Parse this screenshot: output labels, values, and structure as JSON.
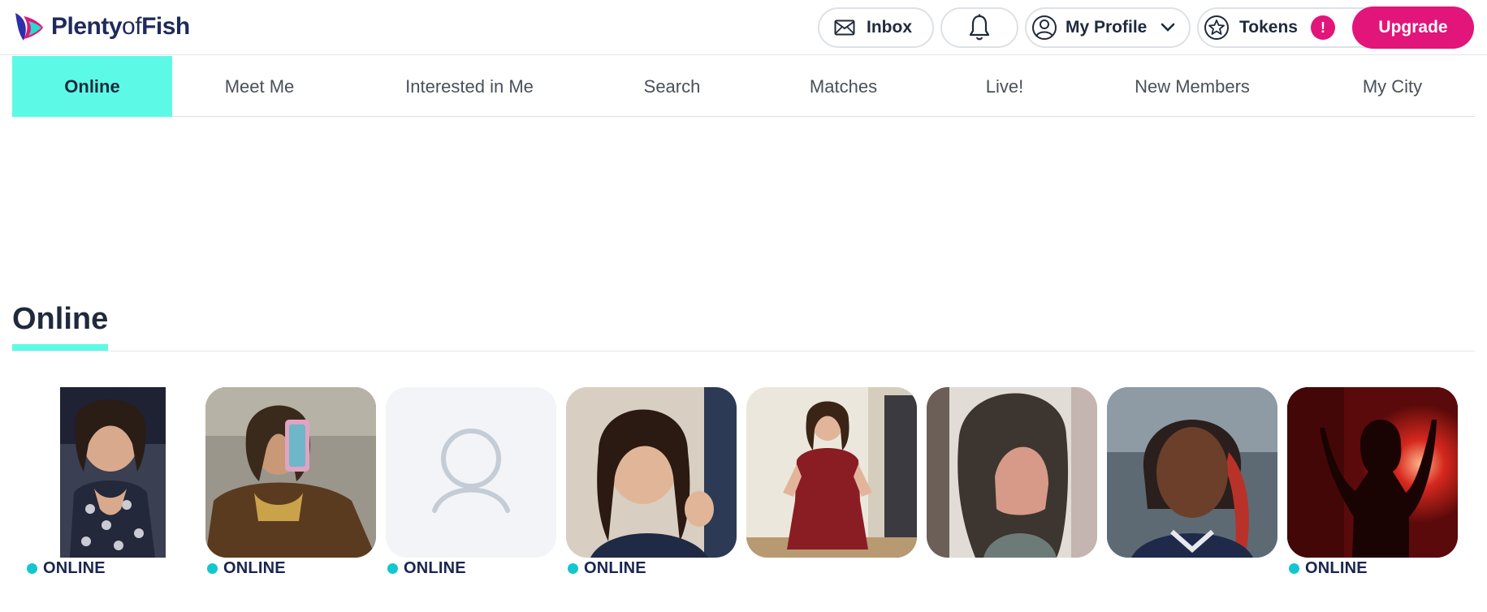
{
  "header": {
    "logo_text_bold": "Plenty",
    "logo_text_light": "of",
    "logo_text_end": "Fish",
    "inbox_label": "Inbox",
    "profile_label": "My Profile",
    "tokens_label": "Tokens",
    "tokens_badge": "!",
    "upgrade_label": "Upgrade",
    "accent_color": "#e2157a"
  },
  "tabs": [
    {
      "label": "Online",
      "active": true
    },
    {
      "label": "Meet Me"
    },
    {
      "label": "Interested in Me"
    },
    {
      "label": "Search"
    },
    {
      "label": "Matches"
    },
    {
      "label": "Live!"
    },
    {
      "label": "New Members"
    },
    {
      "label": "My City"
    }
  ],
  "section": {
    "title": "Online",
    "highlight_color": "#5cfae6"
  },
  "profiles": [
    {
      "photo": "woman-selfie-floral-top",
      "status": "ONLINE"
    },
    {
      "photo": "woman-mirror-selfie-fur-coat",
      "status": "ONLINE"
    },
    {
      "photo": "default-avatar-icon",
      "status": "ONLINE"
    },
    {
      "photo": "woman-smiling-selfie",
      "status": "ONLINE"
    },
    {
      "photo": "woman-red-dress-full-length",
      "status": ""
    },
    {
      "photo": "woman-long-dark-hair",
      "status": ""
    },
    {
      "photo": "woman-braids-car-selfie",
      "status": ""
    },
    {
      "photo": "silhouette-red-light",
      "status": "ONLINE"
    }
  ]
}
